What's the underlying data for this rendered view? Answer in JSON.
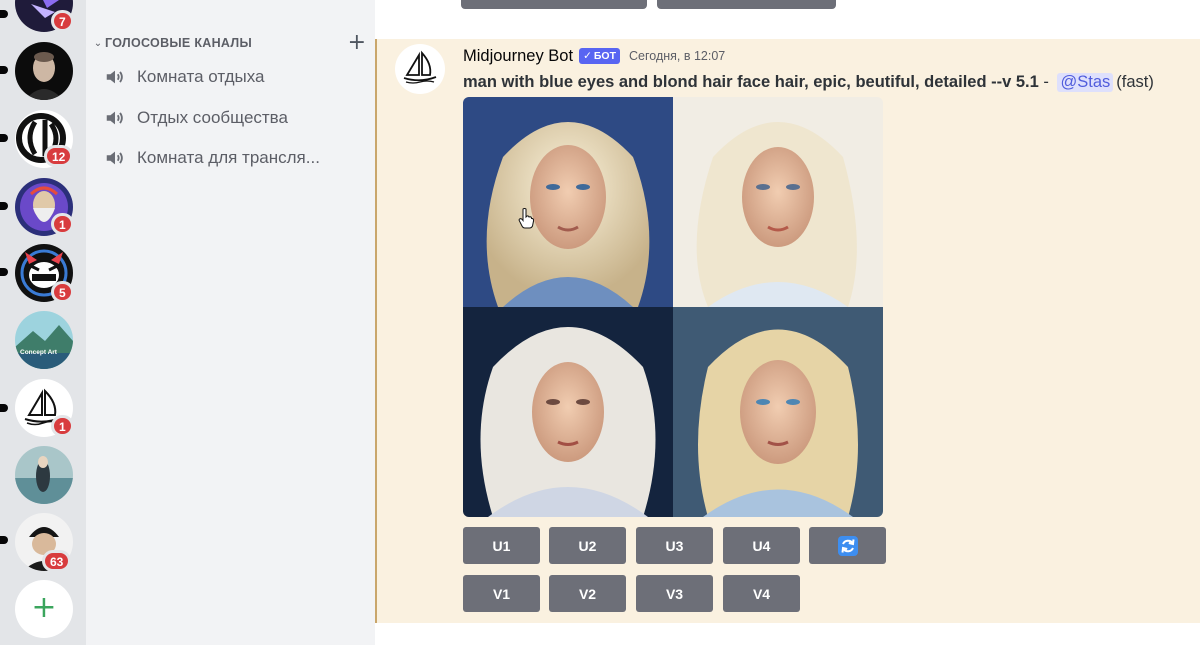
{
  "servers": [
    {
      "id": "s1",
      "badge": "7"
    },
    {
      "id": "s2",
      "badge": ""
    },
    {
      "id": "s3",
      "badge": "12"
    },
    {
      "id": "s4",
      "badge": "1"
    },
    {
      "id": "s5",
      "badge": "5"
    },
    {
      "id": "s6",
      "badge": "",
      "label": "Concept Art"
    },
    {
      "id": "s7",
      "badge": "1"
    },
    {
      "id": "s8",
      "badge": ""
    },
    {
      "id": "s9",
      "badge": "63"
    }
  ],
  "add_server_icon": "plus-icon",
  "channels": {
    "category": "ГОЛОСОВЫЕ КАНАЛЫ",
    "items": [
      {
        "name": "Комната отдыха",
        "icon": "speaker-icon"
      },
      {
        "name": "Отдых сообщества",
        "icon": "speaker-icon"
      },
      {
        "name": "Комната для трансля...",
        "icon": "speaker-icon"
      }
    ]
  },
  "message": {
    "author": "Midjourney Bot",
    "bot_tag": "БОТ",
    "timestamp": "Сегодня, в 12:07",
    "prompt": "man with blue eyes and blond hair face hair, epic, beutiful, detailed --v 5.1",
    "separator": " - ",
    "mention": "@Stas",
    "mode": "(fast)",
    "upscale_buttons": [
      "U1",
      "U2",
      "U3",
      "U4"
    ],
    "variation_buttons": [
      "V1",
      "V2",
      "V3",
      "V4"
    ],
    "reroll_icon": "refresh-icon"
  },
  "colors": {
    "accent": "#5865f2",
    "button": "#6d6f78",
    "message_highlight": "#faf1e0",
    "badge": "#d83c3e"
  }
}
